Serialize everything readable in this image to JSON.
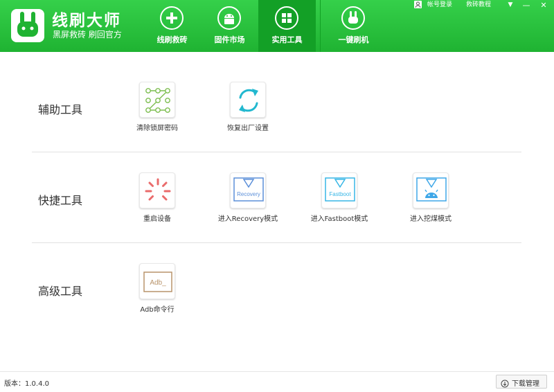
{
  "app": {
    "title": "线刷大师",
    "subtitle": "黑屏救砖 刷回官方",
    "brand_color": "#2cc33e",
    "active_tab_color": "#13a026"
  },
  "nav": {
    "tabs": [
      {
        "label": "线刷救砖",
        "icon": "plus-circle-icon",
        "active": false
      },
      {
        "label": "固件市场",
        "icon": "android-icon",
        "active": false
      },
      {
        "label": "实用工具",
        "icon": "grid-icon",
        "active": true
      },
      {
        "label": "一键刷机",
        "icon": "rabbit-icon",
        "active": false
      }
    ]
  },
  "top_links": {
    "account": "帐号登录",
    "tutorial": "救砖教程"
  },
  "window_controls": {
    "menu": "▼",
    "minimize": "—",
    "close": "✕"
  },
  "sections": [
    {
      "title": "辅助工具",
      "tools": [
        {
          "label": "清除锁屏密码",
          "icon": "pattern-lock-icon",
          "color": "#7cbd4e"
        },
        {
          "label": "恢复出厂设置",
          "icon": "refresh-icon",
          "color": "#22b8cf"
        }
      ]
    },
    {
      "title": "快捷工具",
      "tools": [
        {
          "label": "重启设备",
          "icon": "spinner-icon",
          "color": "#ea6b6b"
        },
        {
          "label": "进入Recovery模式",
          "icon": "recovery-icon",
          "icon_text": "Recovery",
          "color": "#5b8fd9"
        },
        {
          "label": "进入Fastboot模式",
          "icon": "fastboot-icon",
          "icon_text": "Fastboot",
          "color": "#37b6e6"
        },
        {
          "label": "进入挖煤模式",
          "icon": "android-download-icon",
          "color": "#3ea7e8"
        }
      ]
    },
    {
      "title": "高级工具",
      "tools": [
        {
          "label": "Adb命令行",
          "icon": "terminal-icon",
          "icon_text": "Adb_",
          "color": "#b8936a"
        }
      ]
    }
  ],
  "footer": {
    "version": "版本：1.0.4.0",
    "download_label": "下载管理"
  }
}
